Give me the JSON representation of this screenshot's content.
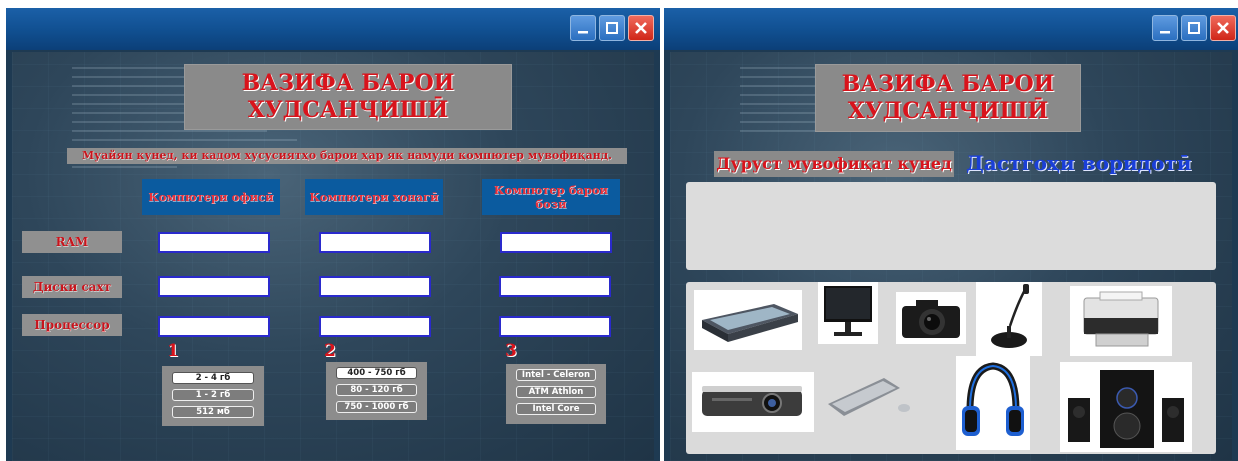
{
  "left_window": {
    "title": "ВАЗИФА БАРОИ ХУДСАНҶИШӢ",
    "title_lines": [
      "ВАЗИФА БАРОИ",
      "ХУДСАНҶИШӢ"
    ],
    "instruction": "Муайян кунед, ки кадом хусусиятҳо барои ҳар як намуди компютер мувофиқанд.",
    "columns": [
      "Компютери офисӣ",
      "Компютери хонагӣ",
      "Компютер барои бозӣ"
    ],
    "rows": [
      "RAM",
      "Диски сахт",
      "Процессор"
    ],
    "option_groups": [
      {
        "number": "1",
        "options": [
          "2 - 4 гб",
          "1 - 2 гб",
          "512 мб"
        ]
      },
      {
        "number": "2",
        "options": [
          "400 - 750 гб",
          "80 - 120 гб",
          "750 - 1000 гб"
        ]
      },
      {
        "number": "3",
        "options": [
          "Intel - Celeron",
          "ATM  Athlon",
          "Intel  Core"
        ]
      }
    ]
  },
  "right_window": {
    "title": "ВАЗИФА БАРОИ ХУДСАНҶИШӢ",
    "title_lines": [
      "ВАЗИФА БАРОИ",
      "ХУДСАНҶИШӢ"
    ],
    "instruction": "Дуруст мувофиқат кунед",
    "category": "Дастгоҳи воридотӣ",
    "devices": [
      "scanner",
      "monitor",
      "camera",
      "microphone",
      "printer",
      "projector",
      "keyboard",
      "headphones",
      "speakers"
    ]
  },
  "window_controls": {
    "minimize": "minimize-icon",
    "maximize": "maximize-icon",
    "close": "close-icon"
  },
  "colors": {
    "titlebar": "#1060a8",
    "title_text": "#d8141c",
    "header_blue": "#0b5b9f",
    "category_blue": "#1a3fd8"
  }
}
